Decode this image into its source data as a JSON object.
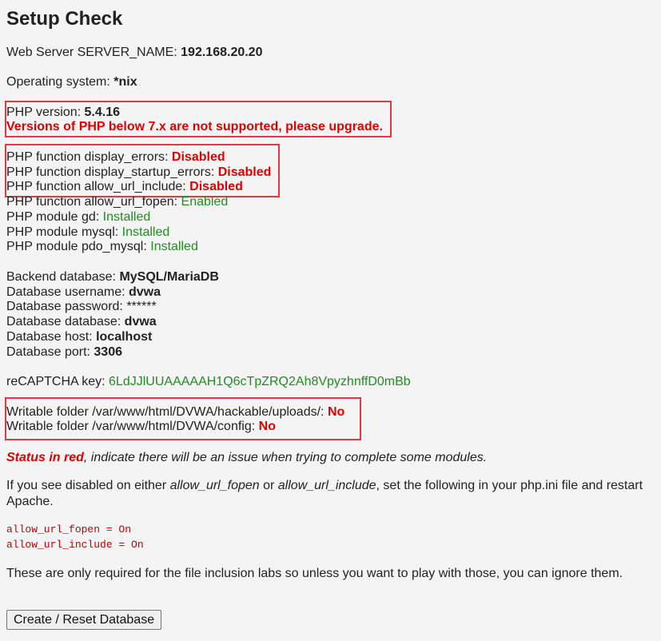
{
  "title": "Setup Check",
  "server": {
    "label": "Web Server SERVER_NAME: ",
    "value": "192.168.20.20"
  },
  "os": {
    "label": "Operating system: ",
    "value": "*nix"
  },
  "php": {
    "label": "PHP version: ",
    "value": "5.4.16",
    "warning": "Versions of PHP below 7.x are not supported, please upgrade."
  },
  "functions": [
    {
      "label": "PHP function display_errors: ",
      "value": "Disabled"
    },
    {
      "label": "PHP function display_startup_errors: ",
      "value": "Disabled"
    },
    {
      "label": "PHP function allow_url_include: ",
      "value": "Disabled"
    },
    {
      "label": "PHP function allow_url_fopen: ",
      "value": "Enabled"
    }
  ],
  "modules": [
    {
      "label": "PHP module gd: ",
      "value": "Installed"
    },
    {
      "label": "PHP module mysql: ",
      "value": "Installed"
    },
    {
      "label": "PHP module pdo_mysql: ",
      "value": "Installed"
    }
  ],
  "database": [
    {
      "label": "Backend database: ",
      "value": "MySQL/MariaDB"
    },
    {
      "label": "Database username: ",
      "value": "dvwa"
    },
    {
      "label": "Database password: ",
      "value": "******"
    },
    {
      "label": "Database database: ",
      "value": "dvwa"
    },
    {
      "label": "Database host: ",
      "value": "localhost"
    },
    {
      "label": "Database port: ",
      "value": "3306"
    }
  ],
  "recaptcha": {
    "label": "reCAPTCHA key: ",
    "value": "6LdJJlUUAAAAAH1Q6cTpZRQ2Ah8VpyzhnffD0mBb"
  },
  "folders": [
    {
      "label": "Writable folder /var/www/html/DVWA/hackable/uploads/: ",
      "value": "No"
    },
    {
      "label": "Writable folder /var/www/html/DVWA/config: ",
      "value": "No"
    }
  ],
  "status_note": {
    "emphasis": "Status in red",
    "rest": ", indicate there will be an issue when trying to complete some modules."
  },
  "instructions": {
    "part1": "If you see disabled on either ",
    "opt1": "allow_url_fopen",
    "part2": " or ",
    "opt2": "allow_url_include",
    "part3": ", set the following in your php.ini file and restart Apache."
  },
  "code_lines": [
    "allow_url_fopen = On",
    "allow_url_include = On"
  ],
  "footer_note": "These are only required for the file inclusion labs so unless you want to play with those, you can ignore them.",
  "button_label": "Create / Reset Database",
  "colors": {
    "error": "#e00000",
    "ok": "#228b22",
    "highlight_box": "#e0393e"
  }
}
